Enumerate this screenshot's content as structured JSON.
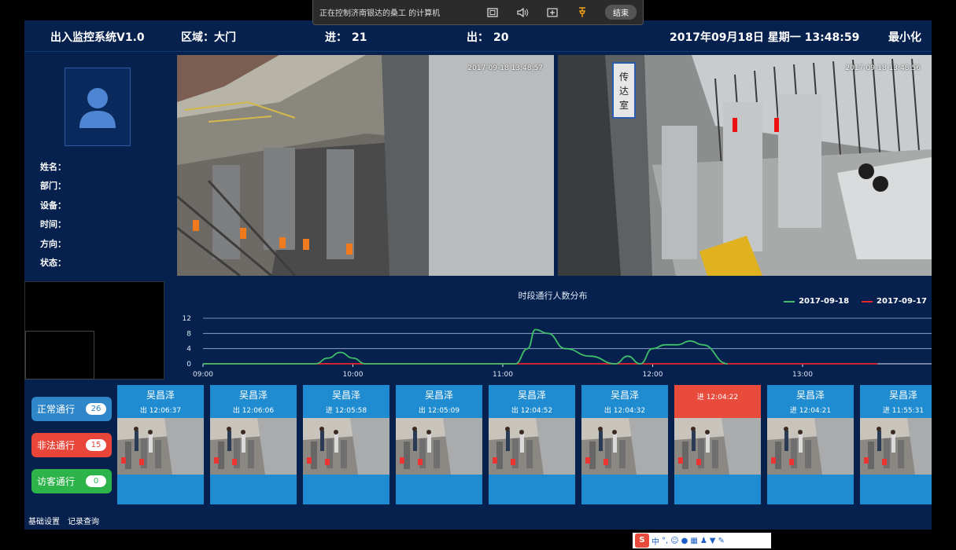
{
  "remote_bar": {
    "title": "正在控制济南银达的桑工 的计算机",
    "end_label": "结束"
  },
  "header": {
    "app_title": "出入监控系统V1.0",
    "area_label": "区域：",
    "area_value": "大门",
    "in_label": "进：",
    "in_value": "21",
    "out_label": "出：",
    "out_value": "20",
    "datetime": "2017年09月18日 星期一 13:48:59",
    "minimize_label": "最小化"
  },
  "person": {
    "fields": [
      "姓名：",
      "部门：",
      "设备：",
      "时间：",
      "方向：",
      "状态："
    ]
  },
  "cameras": [
    {
      "timestamp": "2017-09-18 13:48:57"
    },
    {
      "timestamp": "2017-09-18 13:48:56"
    }
  ],
  "chart_data": {
    "type": "line",
    "title": "时段通行人数分布",
    "legend": {
      "placement": "top-right"
    },
    "x_ticks": [
      "09:00",
      "10:00",
      "11:00",
      "12:00",
      "13:00"
    ],
    "y_ticks": [
      "0",
      "4",
      "8",
      "12"
    ],
    "ylim": [
      0,
      12
    ],
    "xlim": [
      "09:00",
      "13:30"
    ],
    "grid": true,
    "series": [
      {
        "name": "2017-09-18",
        "color": "#3fbf6a",
        "x": [
          "09:00",
          "09:45",
          "09:50",
          "09:55",
          "10:00",
          "10:05",
          "11:05",
          "11:10",
          "11:13",
          "11:18",
          "11:25",
          "11:35",
          "11:45",
          "11:50",
          "11:55",
          "12:00",
          "12:05",
          "12:10",
          "12:15",
          "12:20",
          "12:30"
        ],
        "y": [
          0,
          0,
          1.5,
          3,
          1.5,
          0,
          0,
          4,
          9,
          8,
          4,
          2,
          0,
          2,
          0,
          4,
          5,
          5,
          6,
          5,
          0
        ]
      },
      {
        "name": "2017-09-17",
        "color": "#e8262b",
        "x": [
          "09:00",
          "13:30"
        ],
        "y": [
          0,
          0
        ]
      }
    ]
  },
  "stats": [
    {
      "label": "正常通行",
      "count": "26",
      "color": "#2f86c9",
      "count_color": "#2f86c9"
    },
    {
      "label": "非法通行",
      "count": "15",
      "color": "#e8463b",
      "count_color": "#e8463b"
    },
    {
      "label": "访客通行",
      "count": "0",
      "color": "#2cb34a",
      "count_color": "#2cb34a"
    }
  ],
  "records": [
    {
      "name": "吴昌泽",
      "dir_time": "出  12:06:37",
      "alarm": false
    },
    {
      "name": "吴昌泽",
      "dir_time": "出  12:06:06",
      "alarm": false
    },
    {
      "name": "吴昌泽",
      "dir_time": "进  12:05:58",
      "alarm": false
    },
    {
      "name": "吴昌泽",
      "dir_time": "出  12:05:09",
      "alarm": false
    },
    {
      "name": "吴昌泽",
      "dir_time": "出  12:04:52",
      "alarm": false
    },
    {
      "name": "吴昌泽",
      "dir_time": "出  12:04:32",
      "alarm": false
    },
    {
      "name": "",
      "dir_time": "进  12:04:22",
      "alarm": true
    },
    {
      "name": "吴昌泽",
      "dir_time": "进  12:04:21",
      "alarm": false
    },
    {
      "name": "吴昌泽",
      "dir_time": "进  11:55:31",
      "alarm": false
    }
  ],
  "footer": {
    "settings_label": "基础设置",
    "records_label": "记录查询"
  },
  "ime": {
    "mode": "中"
  }
}
